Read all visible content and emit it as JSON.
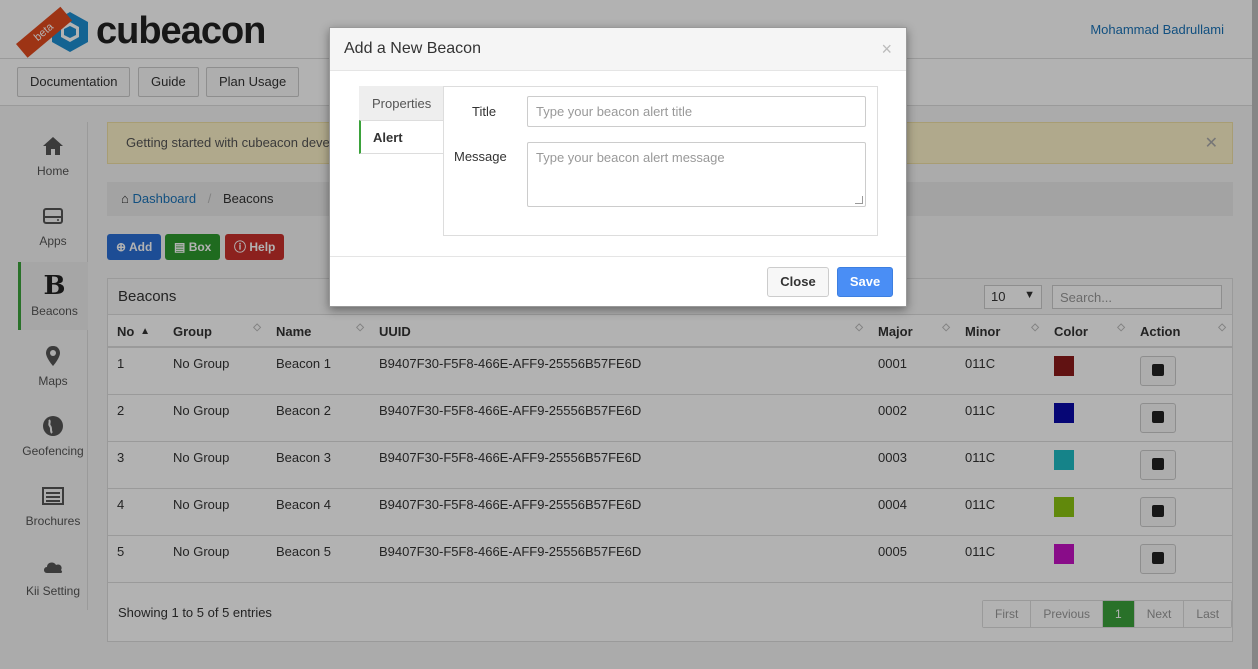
{
  "app": {
    "logo_text": "cubeacon",
    "beta": "beta",
    "user": "Mohammad Badrullami"
  },
  "topnav": {
    "items": [
      "Documentation",
      "Guide",
      "Plan Usage"
    ]
  },
  "sidebar": {
    "items": [
      {
        "label": "Home",
        "icon": "home-icon"
      },
      {
        "label": "Apps",
        "icon": "hdd-icon"
      },
      {
        "label": "Beacons",
        "icon": "beacon-b-icon",
        "active": true
      },
      {
        "label": "Maps",
        "icon": "map-marker-icon"
      },
      {
        "label": "Geofencing",
        "icon": "globe-icon"
      },
      {
        "label": "Brochures",
        "icon": "list-icon"
      },
      {
        "label": "Kii Setting",
        "icon": "cloud-icon"
      }
    ]
  },
  "notice": {
    "text": "Getting started with cubeacon deve"
  },
  "breadcrumb": {
    "home": "Dashboard",
    "current": "Beacons"
  },
  "actions": {
    "add": "Add",
    "box": "Box",
    "help": "Help"
  },
  "panel": {
    "title": "Beacons",
    "page_size": "10",
    "search_placeholder": "Search...",
    "columns": [
      "No",
      "Group",
      "Name",
      "UUID",
      "Major",
      "Minor",
      "Color",
      "Action"
    ],
    "rows": [
      {
        "no": "1",
        "group": "No Group",
        "name": "Beacon 1",
        "uuid": "B9407F30-F5F8-466E-AFF9-25556B57FE6D",
        "major": "0001",
        "minor": "011C",
        "color": "#8b1a1a"
      },
      {
        "no": "2",
        "group": "No Group",
        "name": "Beacon 2",
        "uuid": "B9407F30-F5F8-466E-AFF9-25556B57FE6D",
        "major": "0002",
        "minor": "011C",
        "color": "#0a0aa8"
      },
      {
        "no": "3",
        "group": "No Group",
        "name": "Beacon 3",
        "uuid": "B9407F30-F5F8-466E-AFF9-25556B57FE6D",
        "major": "0003",
        "minor": "011C",
        "color": "#1fbcc4"
      },
      {
        "no": "4",
        "group": "No Group",
        "name": "Beacon 4",
        "uuid": "B9407F30-F5F8-466E-AFF9-25556B57FE6D",
        "major": "0004",
        "minor": "011C",
        "color": "#8cc412"
      },
      {
        "no": "5",
        "group": "No Group",
        "name": "Beacon 5",
        "uuid": "B9407F30-F5F8-466E-AFF9-25556B57FE6D",
        "major": "0005",
        "minor": "011C",
        "color": "#c412c4"
      }
    ],
    "info": "Showing 1 to 5 of 5 entries",
    "pager": [
      "First",
      "Previous",
      "1",
      "Next",
      "Last"
    ]
  },
  "modal": {
    "title": "Add a New Beacon",
    "close_symbol": "×",
    "tabs": {
      "properties": "Properties",
      "alert": "Alert"
    },
    "fields": {
      "title_label": "Title",
      "title_placeholder": "Type your beacon alert title",
      "message_label": "Message",
      "message_placeholder": "Type your beacon alert message"
    },
    "buttons": {
      "close": "Close",
      "save": "Save"
    }
  },
  "colors": {
    "accent_green": "#3ba23b",
    "primary_blue": "#4a8ef5",
    "link_blue": "#1a73b8"
  }
}
